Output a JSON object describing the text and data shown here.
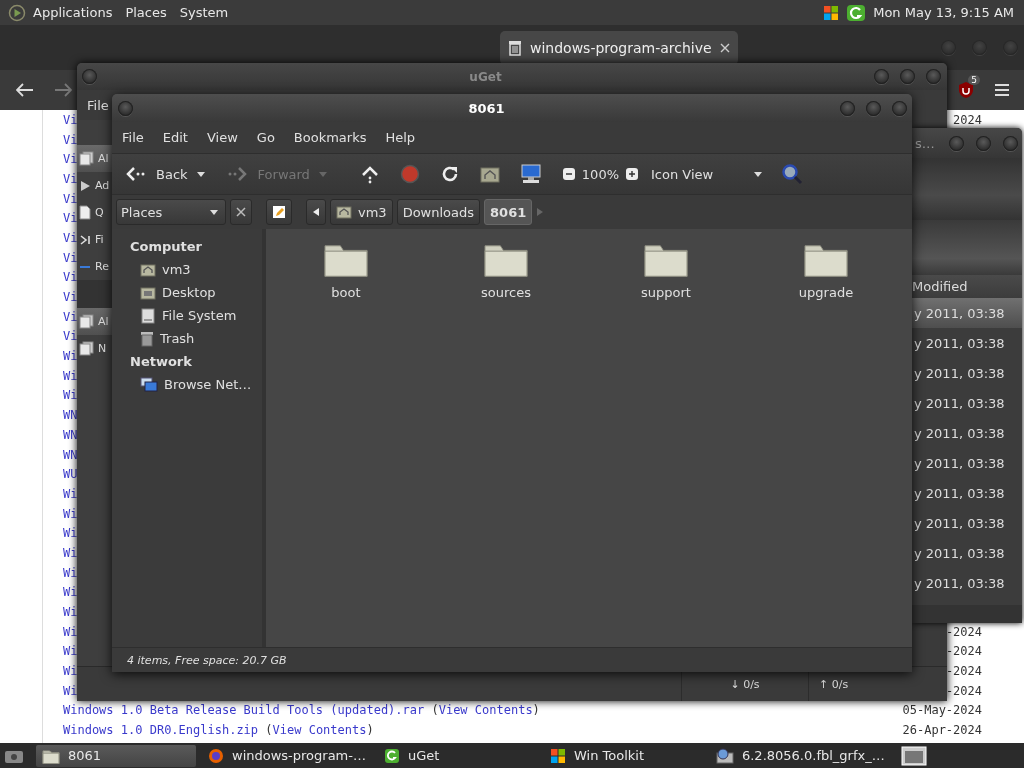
{
  "top_panel": {
    "menus": [
      "Applications",
      "Places",
      "System"
    ],
    "clock": "Mon May 13, 9:15 AM"
  },
  "browser": {
    "tabs": [
      {
        "label": "windows-program-archive",
        "selected": true
      }
    ],
    "extension_badge": "5",
    "listing": [
      {
        "name": "Vi",
        "date": "2024"
      },
      {
        "name": "Vi"
      },
      {
        "name": "Vi"
      },
      {
        "name": "Vi"
      },
      {
        "name": "Vi"
      },
      {
        "name": "Vi"
      },
      {
        "name": "Vi"
      },
      {
        "name": "Vi"
      },
      {
        "name": "Vi"
      },
      {
        "name": "Vi"
      },
      {
        "name": "Vi"
      },
      {
        "name": "Vi"
      },
      {
        "name": "Wi"
      },
      {
        "name": "Wi"
      },
      {
        "name": "Wi"
      },
      {
        "name": "WN"
      },
      {
        "name": "WN"
      },
      {
        "name": "WN"
      },
      {
        "name": "WU"
      },
      {
        "name": "Wi"
      },
      {
        "name": "Wi"
      },
      {
        "name": "Wi"
      },
      {
        "name": "Wi"
      },
      {
        "name": "Wi"
      },
      {
        "name": "Wi"
      },
      {
        "name": "Wi"
      },
      {
        "name": "Wi",
        "date": "-2024"
      },
      {
        "name": "Wi",
        "date": "-2024"
      },
      {
        "name": "Wi",
        "date": "-2024"
      },
      {
        "name": "Wi",
        "date": "-2024"
      },
      {
        "name": "Windows 1.0 Beta Release Build Tools (updated).rar",
        "link_before": " (",
        "link": "View Contents",
        "link_after": ")",
        "date": "05-May-2024"
      },
      {
        "name": "Windows 1.0 DR0.English.zip",
        "link_before": " (",
        "link": "View Contents",
        "link_after": ")",
        "date": "26-Apr-2024"
      }
    ]
  },
  "uget": {
    "title": "uGet",
    "menu": [
      "File"
    ],
    "category_groups": [
      [
        {
          "label": "Al",
          "kind": "stack",
          "selected": true
        },
        {
          "label": "Ad",
          "kind": "play",
          "selected": false
        },
        {
          "label": "Q",
          "kind": "document",
          "selected": false
        },
        {
          "label": "Fi",
          "kind": "skip",
          "selected": false
        },
        {
          "label": "Re",
          "kind": "dash",
          "selected": false
        }
      ],
      [
        {
          "label": "Al",
          "kind": "stack",
          "selected": true
        },
        {
          "label": "N",
          "kind": "stack",
          "selected": false
        }
      ]
    ],
    "download_speed": "↓ 0/s",
    "upload_speed": "↑ 0/s"
  },
  "file_list_window": {
    "title": "s…",
    "column": "Modified",
    "rows": [
      {
        "modified": "y 2011, 03:38",
        "selected": true
      },
      {
        "modified": "y 2011, 03:38",
        "selected": false
      },
      {
        "modified": "y 2011, 03:38",
        "selected": false
      },
      {
        "modified": "y 2011, 03:38",
        "selected": false
      },
      {
        "modified": "y 2011, 03:38",
        "selected": false
      },
      {
        "modified": "y 2011, 03:38",
        "selected": false
      },
      {
        "modified": "y 2011, 03:38",
        "selected": false
      },
      {
        "modified": "y 2011, 03:38",
        "selected": false
      },
      {
        "modified": "y 2011, 03:38",
        "selected": false
      },
      {
        "modified": "y 2011, 03:38",
        "selected": false
      }
    ]
  },
  "file_manager": {
    "title": "8061",
    "menu": [
      "File",
      "Edit",
      "View",
      "Go",
      "Bookmarks",
      "Help"
    ],
    "nav_buttons": [
      {
        "label": "Back",
        "disabled": false
      },
      {
        "label": "Forward",
        "disabled": true
      }
    ],
    "zoom": "100%",
    "view_mode": "Icon View",
    "sidebar_selector": "Places",
    "path": [
      {
        "label": "vm3",
        "kind": "home",
        "selected": false
      },
      {
        "label": "Downloads",
        "kind": "plain",
        "selected": false
      },
      {
        "label": "8061",
        "kind": "plain",
        "selected": true
      }
    ],
    "sidebar": [
      {
        "heading": "Computer",
        "items": [
          {
            "label": "vm3",
            "kind": "home",
            "selected": false
          },
          {
            "label": "Desktop",
            "kind": "desktop",
            "selected": false
          },
          {
            "label": "File System",
            "kind": "drive",
            "selected": false
          },
          {
            "label": "Trash",
            "kind": "trash",
            "selected": false
          }
        ]
      },
      {
        "heading": "Network",
        "items": [
          {
            "label": "Browse Net…",
            "kind": "network",
            "selected": false
          }
        ]
      }
    ],
    "files": [
      {
        "name": "boot"
      },
      {
        "name": "sources"
      },
      {
        "name": "support"
      },
      {
        "name": "upgrade"
      }
    ],
    "status": "4 items, Free space: 20.7 GB"
  },
  "taskbar": {
    "tasks": [
      {
        "label": "8061",
        "kind": "folder",
        "selected": true
      },
      {
        "label": "windows-program-…",
        "kind": "browser",
        "selected": false
      },
      {
        "label": "uGet",
        "kind": "uget",
        "selected": false
      },
      {
        "label": "Win Toolkit",
        "kind": "windows",
        "selected": false
      },
      {
        "label": "6.2.8056.0.fbl_grfx_…",
        "kind": "installer",
        "selected": false
      }
    ]
  }
}
